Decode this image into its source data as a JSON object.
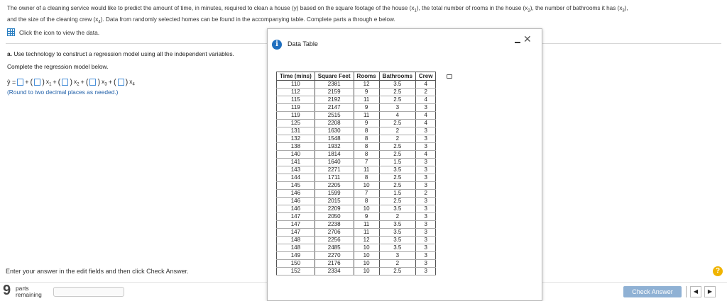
{
  "question": {
    "intro_1": "The owner of a cleaning service would like to predict the amount of time, in minutes, required to clean a house (y) based on the square footage of the house (x",
    "intro_2": "), the total number of rooms in the house (x",
    "intro_3": "), the number of bathrooms it has (x",
    "intro_4": "),",
    "intro_5": "and the size of the cleaning crew (x",
    "intro_6": "). Data from randomly selected homes can be found in the accompanying table. Complete parts a through e below.",
    "sub1": "1",
    "sub2": "2",
    "sub3": "3",
    "sub4": "4",
    "view_data": "Click the icon to view the data."
  },
  "part_a": {
    "label": "a.",
    "text": "Use technology to construct a regression model using all the independent variables.",
    "complete": "Complete the regression model below.",
    "eq_yhat": "ŷ =",
    "plus": "+",
    "x": "x",
    "round_note": "(Round to two decimal places as needed.)"
  },
  "dialog": {
    "title": "Data Table",
    "info_glyph": "i",
    "close_glyph": "✕",
    "headers": [
      "Time (mins)",
      "Square Feet",
      "Rooms",
      "Bathrooms",
      "Crew"
    ],
    "rows": [
      [
        "110",
        "2381",
        "12",
        "3.5",
        "4"
      ],
      [
        "112",
        "2159",
        "9",
        "2.5",
        "2"
      ],
      [
        "115",
        "2192",
        "11",
        "2.5",
        "4"
      ],
      [
        "119",
        "2147",
        "9",
        "3",
        "3"
      ],
      [
        "119",
        "2515",
        "11",
        "4",
        "4"
      ],
      [
        "125",
        "2208",
        "9",
        "2.5",
        "4"
      ],
      [
        "131",
        "1630",
        "8",
        "2",
        "3"
      ],
      [
        "132",
        "1548",
        "8",
        "2",
        "3"
      ],
      [
        "138",
        "1932",
        "8",
        "2.5",
        "3"
      ],
      [
        "140",
        "1814",
        "8",
        "2.5",
        "4"
      ],
      [
        "141",
        "1640",
        "7",
        "1.5",
        "3"
      ],
      [
        "143",
        "2271",
        "11",
        "3.5",
        "3"
      ],
      [
        "144",
        "1711",
        "8",
        "2.5",
        "3"
      ],
      [
        "145",
        "2205",
        "10",
        "2.5",
        "3"
      ],
      [
        "146",
        "1599",
        "7",
        "1.5",
        "2"
      ],
      [
        "146",
        "2015",
        "8",
        "2.5",
        "3"
      ],
      [
        "146",
        "2209",
        "10",
        "3.5",
        "3"
      ],
      [
        "147",
        "2050",
        "9",
        "2",
        "3"
      ],
      [
        "147",
        "2238",
        "11",
        "3.5",
        "3"
      ],
      [
        "147",
        "2706",
        "11",
        "3.5",
        "3"
      ],
      [
        "148",
        "2256",
        "12",
        "3.5",
        "3"
      ],
      [
        "148",
        "2485",
        "10",
        "3.5",
        "3"
      ],
      [
        "149",
        "2270",
        "10",
        "3",
        "3"
      ],
      [
        "150",
        "2176",
        "10",
        "2",
        "3"
      ],
      [
        "152",
        "2334",
        "10",
        "2.5",
        "3"
      ]
    ]
  },
  "footer": {
    "instruction": "Enter your answer in the edit fields and then click Check Answer.",
    "help_glyph": "?",
    "parts_remaining_count": "9",
    "parts_label": "parts",
    "remaining_label": "remaining",
    "progress_fraction": 0,
    "check_answer": "Check Answer",
    "prev_glyph": "◀",
    "next_glyph": "▶"
  },
  "colors": {
    "accent": "#2a7fc1",
    "link_blue": "#1f5fa8",
    "help_yellow": "#f0b400",
    "check_button": "#8fb1d4"
  }
}
